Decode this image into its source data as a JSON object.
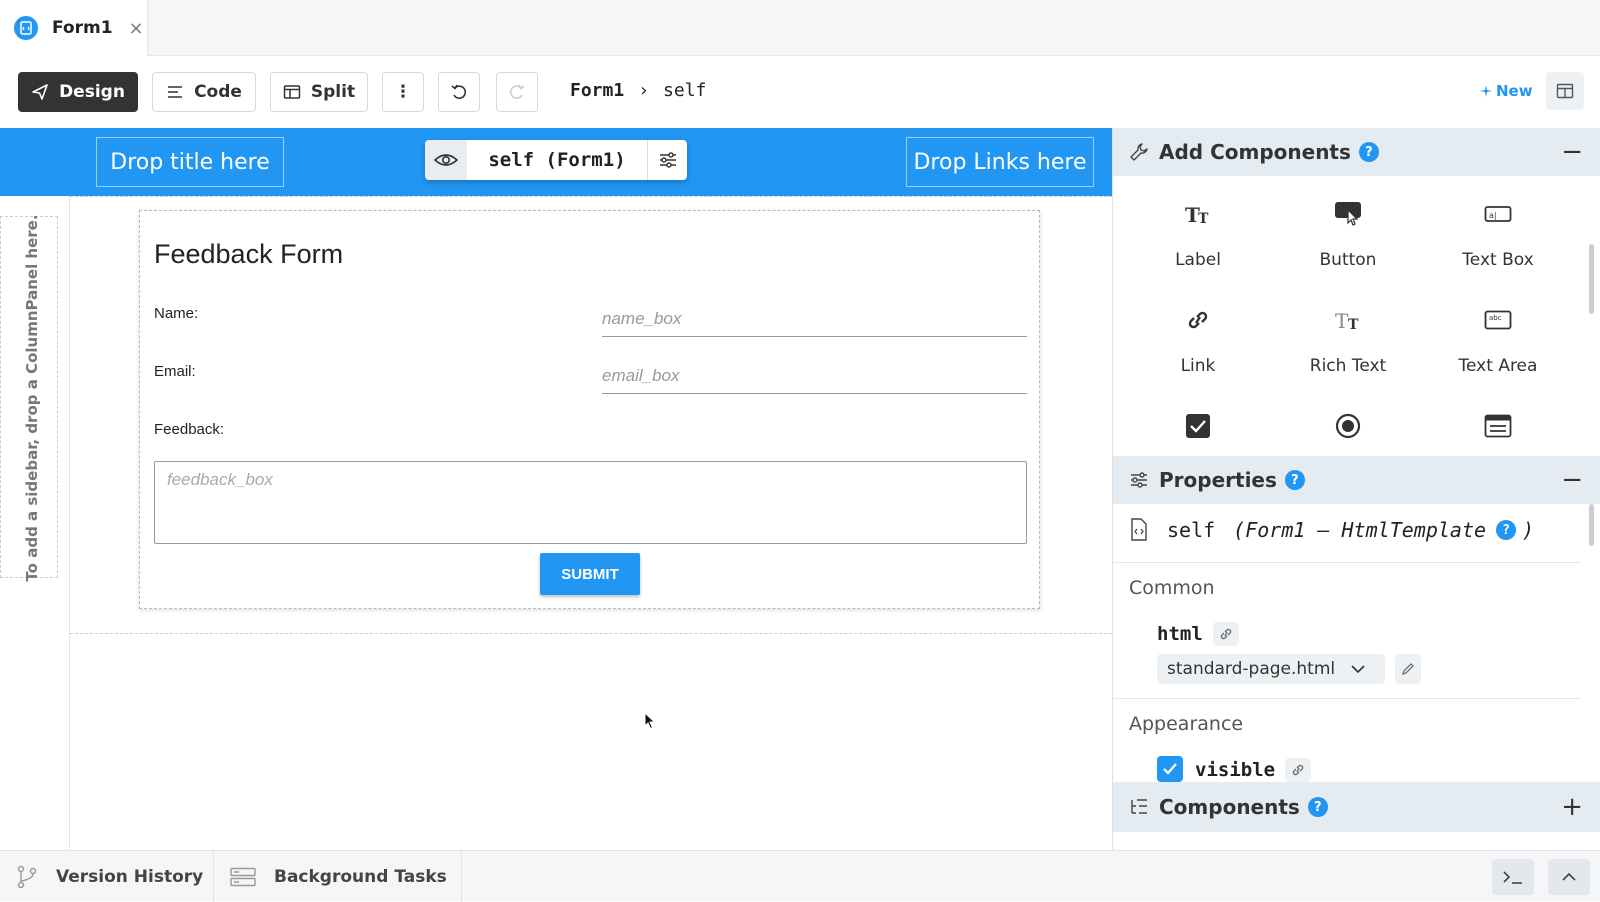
{
  "tab": {
    "label": "Form1",
    "close": "×"
  },
  "toolbar": {
    "design": "Design",
    "code": "Code",
    "split": "Split",
    "more": "⋮",
    "breadcrumb_form": "Form1",
    "breadcrumb_sep": "›",
    "breadcrumb_self": "self",
    "new": "New"
  },
  "canvas": {
    "drop_title": "Drop title here",
    "drop_links": "Drop Links here",
    "selector": "self (Form1)",
    "sidebar_hint": "To add a sidebar, drop a ColumnPanel here."
  },
  "form": {
    "title": "Feedback Form",
    "name_label": "Name:",
    "name_placeholder": "name_box",
    "email_label": "Email:",
    "email_placeholder": "email_box",
    "feedback_label": "Feedback:",
    "feedback_placeholder": "feedback_box",
    "submit": "SUBMIT"
  },
  "add_components": {
    "title": "Add Components",
    "help": "?",
    "collapse": "−",
    "items": [
      {
        "label": "Label",
        "icon": "label-icon"
      },
      {
        "label": "Button",
        "icon": "button-icon"
      },
      {
        "label": "Text Box",
        "icon": "textbox-icon"
      },
      {
        "label": "Link",
        "icon": "link-icon"
      },
      {
        "label": "Rich Text",
        "icon": "richtext-icon"
      },
      {
        "label": "Text Area",
        "icon": "textarea-icon"
      },
      {
        "label": "",
        "icon": "checkbox-icon"
      },
      {
        "label": "",
        "icon": "radio-icon"
      },
      {
        "label": "",
        "icon": "dropdown-icon"
      }
    ]
  },
  "properties": {
    "title": "Properties",
    "help": "?",
    "collapse": "−",
    "self_name": "self",
    "self_type": "(Form1 – HtmlTemplate",
    "self_type_close": ")",
    "common": "Common",
    "html_prop": "html",
    "html_value": "standard-page.html",
    "appearance": "Appearance",
    "visible_prop": "visible",
    "visible_checked": true
  },
  "components_panel": {
    "title": "Components",
    "help": "?",
    "expand": "+"
  },
  "bottom": {
    "version_history": "Version History",
    "background_tasks": "Background Tasks"
  },
  "colors": {
    "accent": "#2196f3",
    "dark_button": "#333333"
  }
}
